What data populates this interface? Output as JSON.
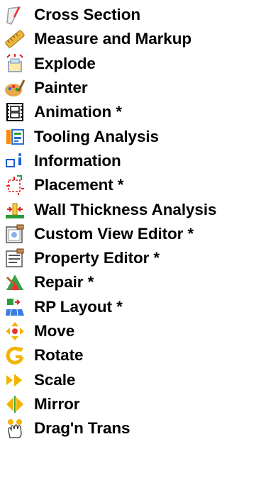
{
  "menu": {
    "items": [
      {
        "label": "Cross Section",
        "icon": "cross-section-icon"
      },
      {
        "label": "Measure and Markup",
        "icon": "ruler-icon"
      },
      {
        "label": "Explode",
        "icon": "explode-icon"
      },
      {
        "label": "Painter",
        "icon": "paint-palette-icon"
      },
      {
        "label": "Animation *",
        "icon": "film-strip-icon"
      },
      {
        "label": "Tooling Analysis",
        "icon": "tooling-analysis-icon"
      },
      {
        "label": "Information",
        "icon": "information-icon"
      },
      {
        "label": "Placement *",
        "icon": "placement-icon"
      },
      {
        "label": "Wall Thickness Analysis",
        "icon": "wall-thickness-icon"
      },
      {
        "label": "Custom View Editor *",
        "icon": "custom-view-editor-icon"
      },
      {
        "label": "Property Editor *",
        "icon": "property-editor-icon"
      },
      {
        "label": "Repair *",
        "icon": "repair-icon"
      },
      {
        "label": "RP Layout *",
        "icon": "rp-layout-icon"
      },
      {
        "label": "Move",
        "icon": "move-arrows-icon"
      },
      {
        "label": "Rotate",
        "icon": "rotate-icon"
      },
      {
        "label": "Scale",
        "icon": "scale-icon"
      },
      {
        "label": "Mirror",
        "icon": "mirror-icon"
      },
      {
        "label": "Drag'n Trans",
        "icon": "hand-drag-icon"
      }
    ]
  }
}
